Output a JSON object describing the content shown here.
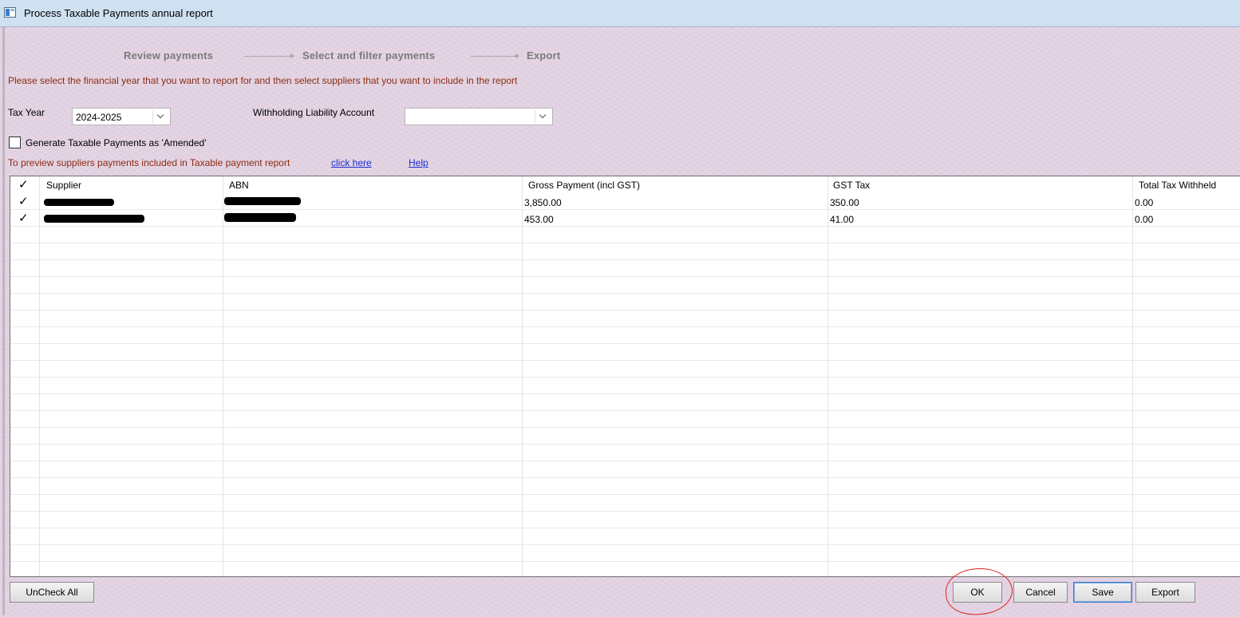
{
  "window": {
    "title": "Process Taxable Payments annual report"
  },
  "wizard": {
    "steps": [
      "Review payments",
      "Select and filter payments",
      "Export"
    ]
  },
  "instructions": "Please select the financial year that you want to report for and then select suppliers that you want to include in the report",
  "filters": {
    "tax_year_label": "Tax Year",
    "tax_year_value": "2024-2025",
    "withholding_label": "Withholding Liability Account",
    "withholding_value": ""
  },
  "amended_checkbox": {
    "label": "Generate Taxable Payments as 'Amended'",
    "checked": false
  },
  "preview": {
    "text": "To preview suppliers payments included in Taxable payment report",
    "link": "click here",
    "help": "Help"
  },
  "table": {
    "check_header": "✓",
    "columns": [
      "Supplier",
      "ABN",
      "Gross Payment (incl GST)",
      "GST Tax",
      "Total Tax Withheld"
    ],
    "rows": [
      {
        "check": "✓",
        "gross": "3,850.00",
        "gst": "350.00",
        "withheld": "0.00"
      },
      {
        "check": "✓",
        "gross": "453.00",
        "gst": "41.00",
        "withheld": "0.00"
      }
    ]
  },
  "buttons": {
    "uncheck_all": "UnCheck All",
    "ok": "OK",
    "cancel": "Cancel",
    "save": "Save",
    "export": "Export"
  },
  "colors": {
    "background": "#e2d2e2",
    "instruction_text": "#8b2c12",
    "link": "#1a2fd4",
    "annotation": "#e02020"
  }
}
